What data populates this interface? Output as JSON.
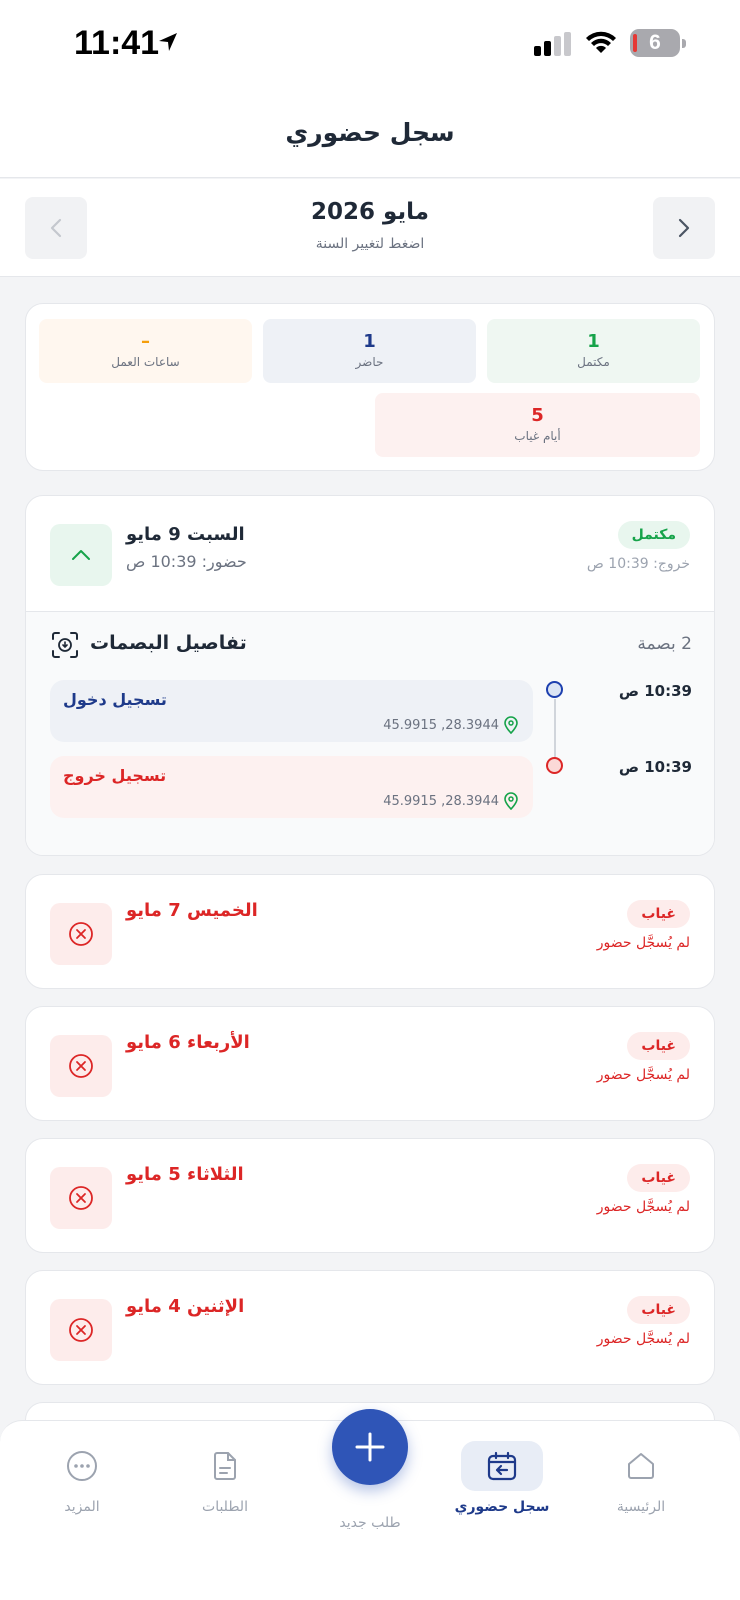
{
  "status_bar": {
    "time": "11:41",
    "battery": "6"
  },
  "header": {
    "title": "سجل حضوري"
  },
  "month": {
    "title": "مايو 2026",
    "hint": "اضغط لتغيير السنة"
  },
  "stats": {
    "complete": {
      "value": "1",
      "label": "مكتمل"
    },
    "present": {
      "value": "1",
      "label": "حاضر"
    },
    "hours": {
      "value": "–",
      "label": "ساعات العمل"
    },
    "absent": {
      "value": "5",
      "label": "أيام غياب"
    }
  },
  "days": [
    {
      "name": "السبت 9 مايو",
      "checkin": "حضور: 10:39 ص",
      "badge": "مكتمل",
      "checkout": "خروج: 10:39 ص",
      "details": {
        "title": "تفاصيل البصمات",
        "count": "2 بصمة",
        "punches": [
          {
            "time": "10:39 ص",
            "label": "تسجيل دخول",
            "coords": "45.9915 ,28.3944"
          },
          {
            "time": "10:39 ص",
            "label": "تسجيل خروج",
            "coords": "45.9915 ,28.3944"
          }
        ]
      }
    },
    {
      "name": "الخميس 7 مايو",
      "badge": "غياب",
      "note": "لم يُسجَّل حضور"
    },
    {
      "name": "الأربعاء 6 مايو",
      "badge": "غياب",
      "note": "لم يُسجَّل حضور"
    },
    {
      "name": "الثلاثاء 5 مايو",
      "badge": "غياب",
      "note": "لم يُسجَّل حضور"
    },
    {
      "name": "الإثنين 4 مايو",
      "badge": "غياب",
      "note": "لم يُسجَّل حضور"
    }
  ],
  "nav": {
    "home": "الرئيسية",
    "attendance": "سجل حضوري",
    "new_request": "طلب جديد",
    "requests": "الطلبات",
    "more": "المزيد"
  },
  "colors": {
    "primary": "#1e3a8a",
    "fab": "#2f55b7",
    "success": "#16a34a",
    "danger": "#dc2626",
    "warning": "#f59e0b"
  }
}
